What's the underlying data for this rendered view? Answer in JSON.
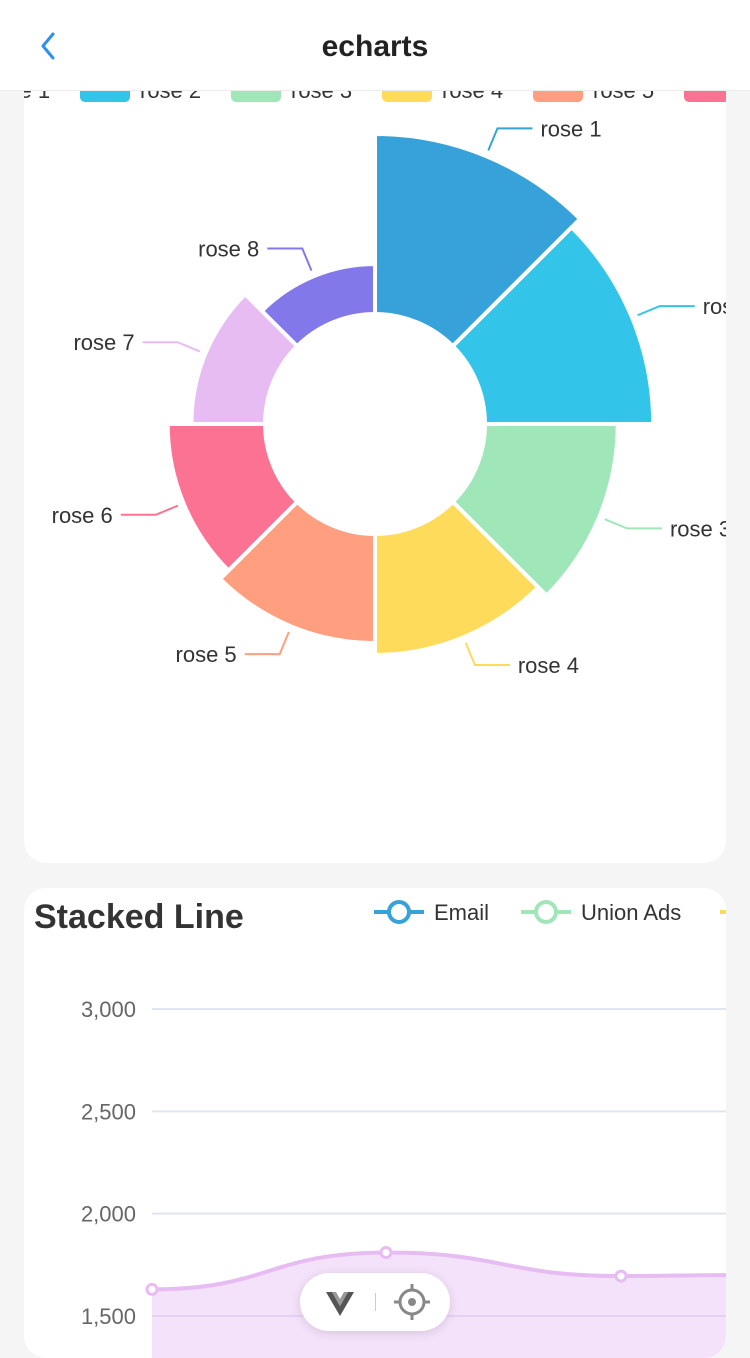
{
  "nav": {
    "title": "echarts",
    "back_icon": "chevron-left-icon"
  },
  "floating_toolbar": {
    "icons": [
      "vue-logo-icon",
      "locate-icon"
    ]
  },
  "charts": {
    "rose": {
      "slices": [
        {
          "name": "rose 1",
          "value": 40,
          "color": "#37a2da"
        },
        {
          "name": "rose 2",
          "value": 38,
          "color": "#32c5e9"
        },
        {
          "name": "rose 3",
          "value": 32,
          "color": "#9fe6b8"
        },
        {
          "name": "rose 4",
          "value": 30,
          "color": "#ffdb5c"
        },
        {
          "name": "rose 5",
          "value": 28,
          "color": "#ff9f7f"
        },
        {
          "name": "rose 6",
          "value": 26,
          "color": "#fb7293"
        },
        {
          "name": "rose 7",
          "value": 22,
          "color": "#e7bcf3"
        },
        {
          "name": "rose 8",
          "value": 18,
          "color": "#8378ea"
        }
      ]
    },
    "stacked": {
      "title": "Stacked Line",
      "legend": [
        {
          "name": "Email",
          "color": "#37a2da"
        },
        {
          "name": "Union Ads",
          "color": "#9fe6b8"
        },
        {
          "name": "",
          "color": "#ffdb5c"
        }
      ],
      "y_ticks": [
        "3,000",
        "2,500",
        "2,000",
        "1,500"
      ],
      "y_values": [
        3000,
        2500,
        2000,
        1500
      ],
      "visible_series_color": "#e7bcf3",
      "visible_points": [
        1630,
        1810,
        1695,
        1700
      ]
    }
  },
  "chart_data": [
    {
      "type": "pie",
      "subtype": "nightingale-rose",
      "title": "",
      "legend_placement": "top",
      "categories": [
        "rose 1",
        "rose 2",
        "rose 3",
        "rose 4",
        "rose 5",
        "rose 6",
        "rose 7",
        "rose 8"
      ],
      "values": [
        40,
        38,
        32,
        30,
        28,
        26,
        22,
        18
      ]
    },
    {
      "type": "line",
      "title": "Stacked Line",
      "legend": [
        "Email",
        "Union Ads"
      ],
      "legend_placement": "top-right",
      "ylim": [
        1500,
        3000
      ],
      "y_ticks": [
        1500,
        2000,
        2500,
        3000
      ],
      "series": [
        {
          "values": [
            1630,
            1810,
            1695,
            1700
          ]
        }
      ],
      "grid": true
    }
  ]
}
